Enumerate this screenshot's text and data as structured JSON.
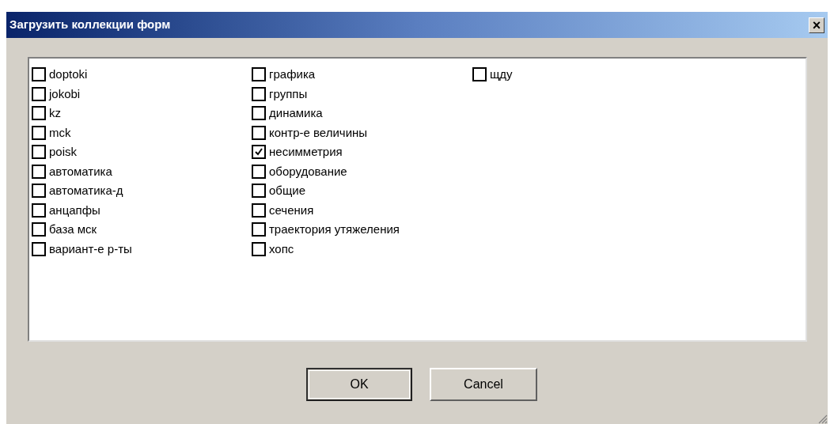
{
  "window": {
    "title": "Загрузить коллекции форм",
    "close": "×"
  },
  "collections": [
    {
      "label": "doptoki",
      "checked": false
    },
    {
      "label": "jokobi",
      "checked": false
    },
    {
      "label": "kz",
      "checked": false
    },
    {
      "label": "mck",
      "checked": false
    },
    {
      "label": "poisk",
      "checked": false
    },
    {
      "label": "автоматика",
      "checked": false
    },
    {
      "label": "автоматика-д",
      "checked": false
    },
    {
      "label": "анцапфы",
      "checked": false
    },
    {
      "label": "база мск",
      "checked": false
    },
    {
      "label": "вариант-е р-ты",
      "checked": false
    },
    {
      "label": "графика",
      "checked": false
    },
    {
      "label": "группы",
      "checked": false
    },
    {
      "label": "динамика",
      "checked": false
    },
    {
      "label": "контр-е величины",
      "checked": false
    },
    {
      "label": "несимметрия",
      "checked": true
    },
    {
      "label": "оборудование",
      "checked": false
    },
    {
      "label": "общие",
      "checked": false
    },
    {
      "label": "сечения",
      "checked": false
    },
    {
      "label": "траектория утяжеления",
      "checked": false
    },
    {
      "label": "хопс",
      "checked": false
    },
    {
      "label": "щду",
      "checked": false
    }
  ],
  "buttons": [
    {
      "label": "OK",
      "default": true
    },
    {
      "label": "Cancel",
      "default": false
    }
  ]
}
